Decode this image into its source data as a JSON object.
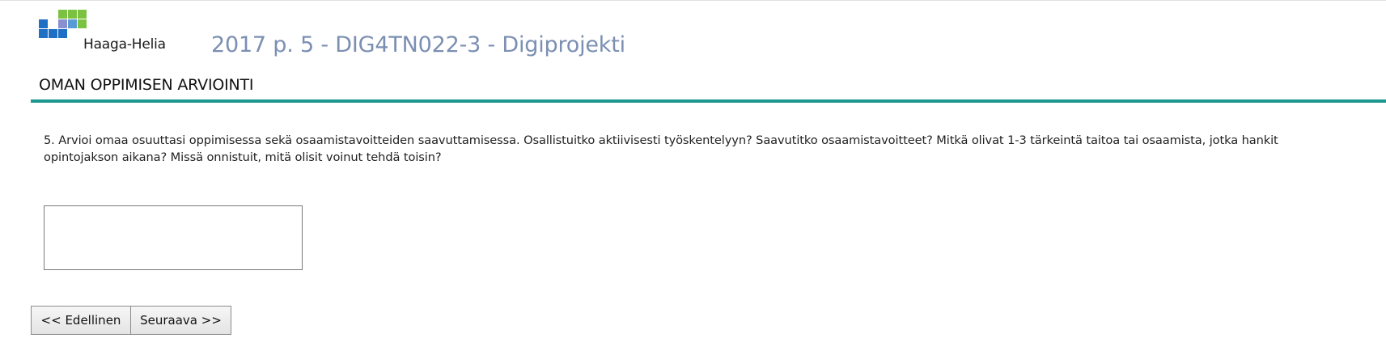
{
  "logo": {
    "name": "Haaga-Helia",
    "colors": {
      "blue": "#1f6fc4",
      "light_blue": "#5b9bd5",
      "purple": "#8a8fcf",
      "green": "#7cc242"
    }
  },
  "header": {
    "course_title": "2017 p. 5 - DIG4TN022-3 - Digiprojekti"
  },
  "section": {
    "title": "OMAN OPPIMISEN ARVIOINTI",
    "rule_color": "#1d968f"
  },
  "question": {
    "text": "5. Arvioi omaa osuuttasi oppimisessa sekä osaamistavoitteiden saavuttamisessa. Osallistuitko aktiivisesti työskentelyyn? Saavutitko osaamistavoitteet? Mitkä olivat 1-3 tärkeintä taitoa tai osaamista, jotka hankit opintojakson aikana? Missä onnistuit, mitä olisit voinut tehdä toisin?",
    "answer_value": ""
  },
  "navigation": {
    "previous_label": "<< Edellinen",
    "next_label": "Seuraava >>"
  }
}
